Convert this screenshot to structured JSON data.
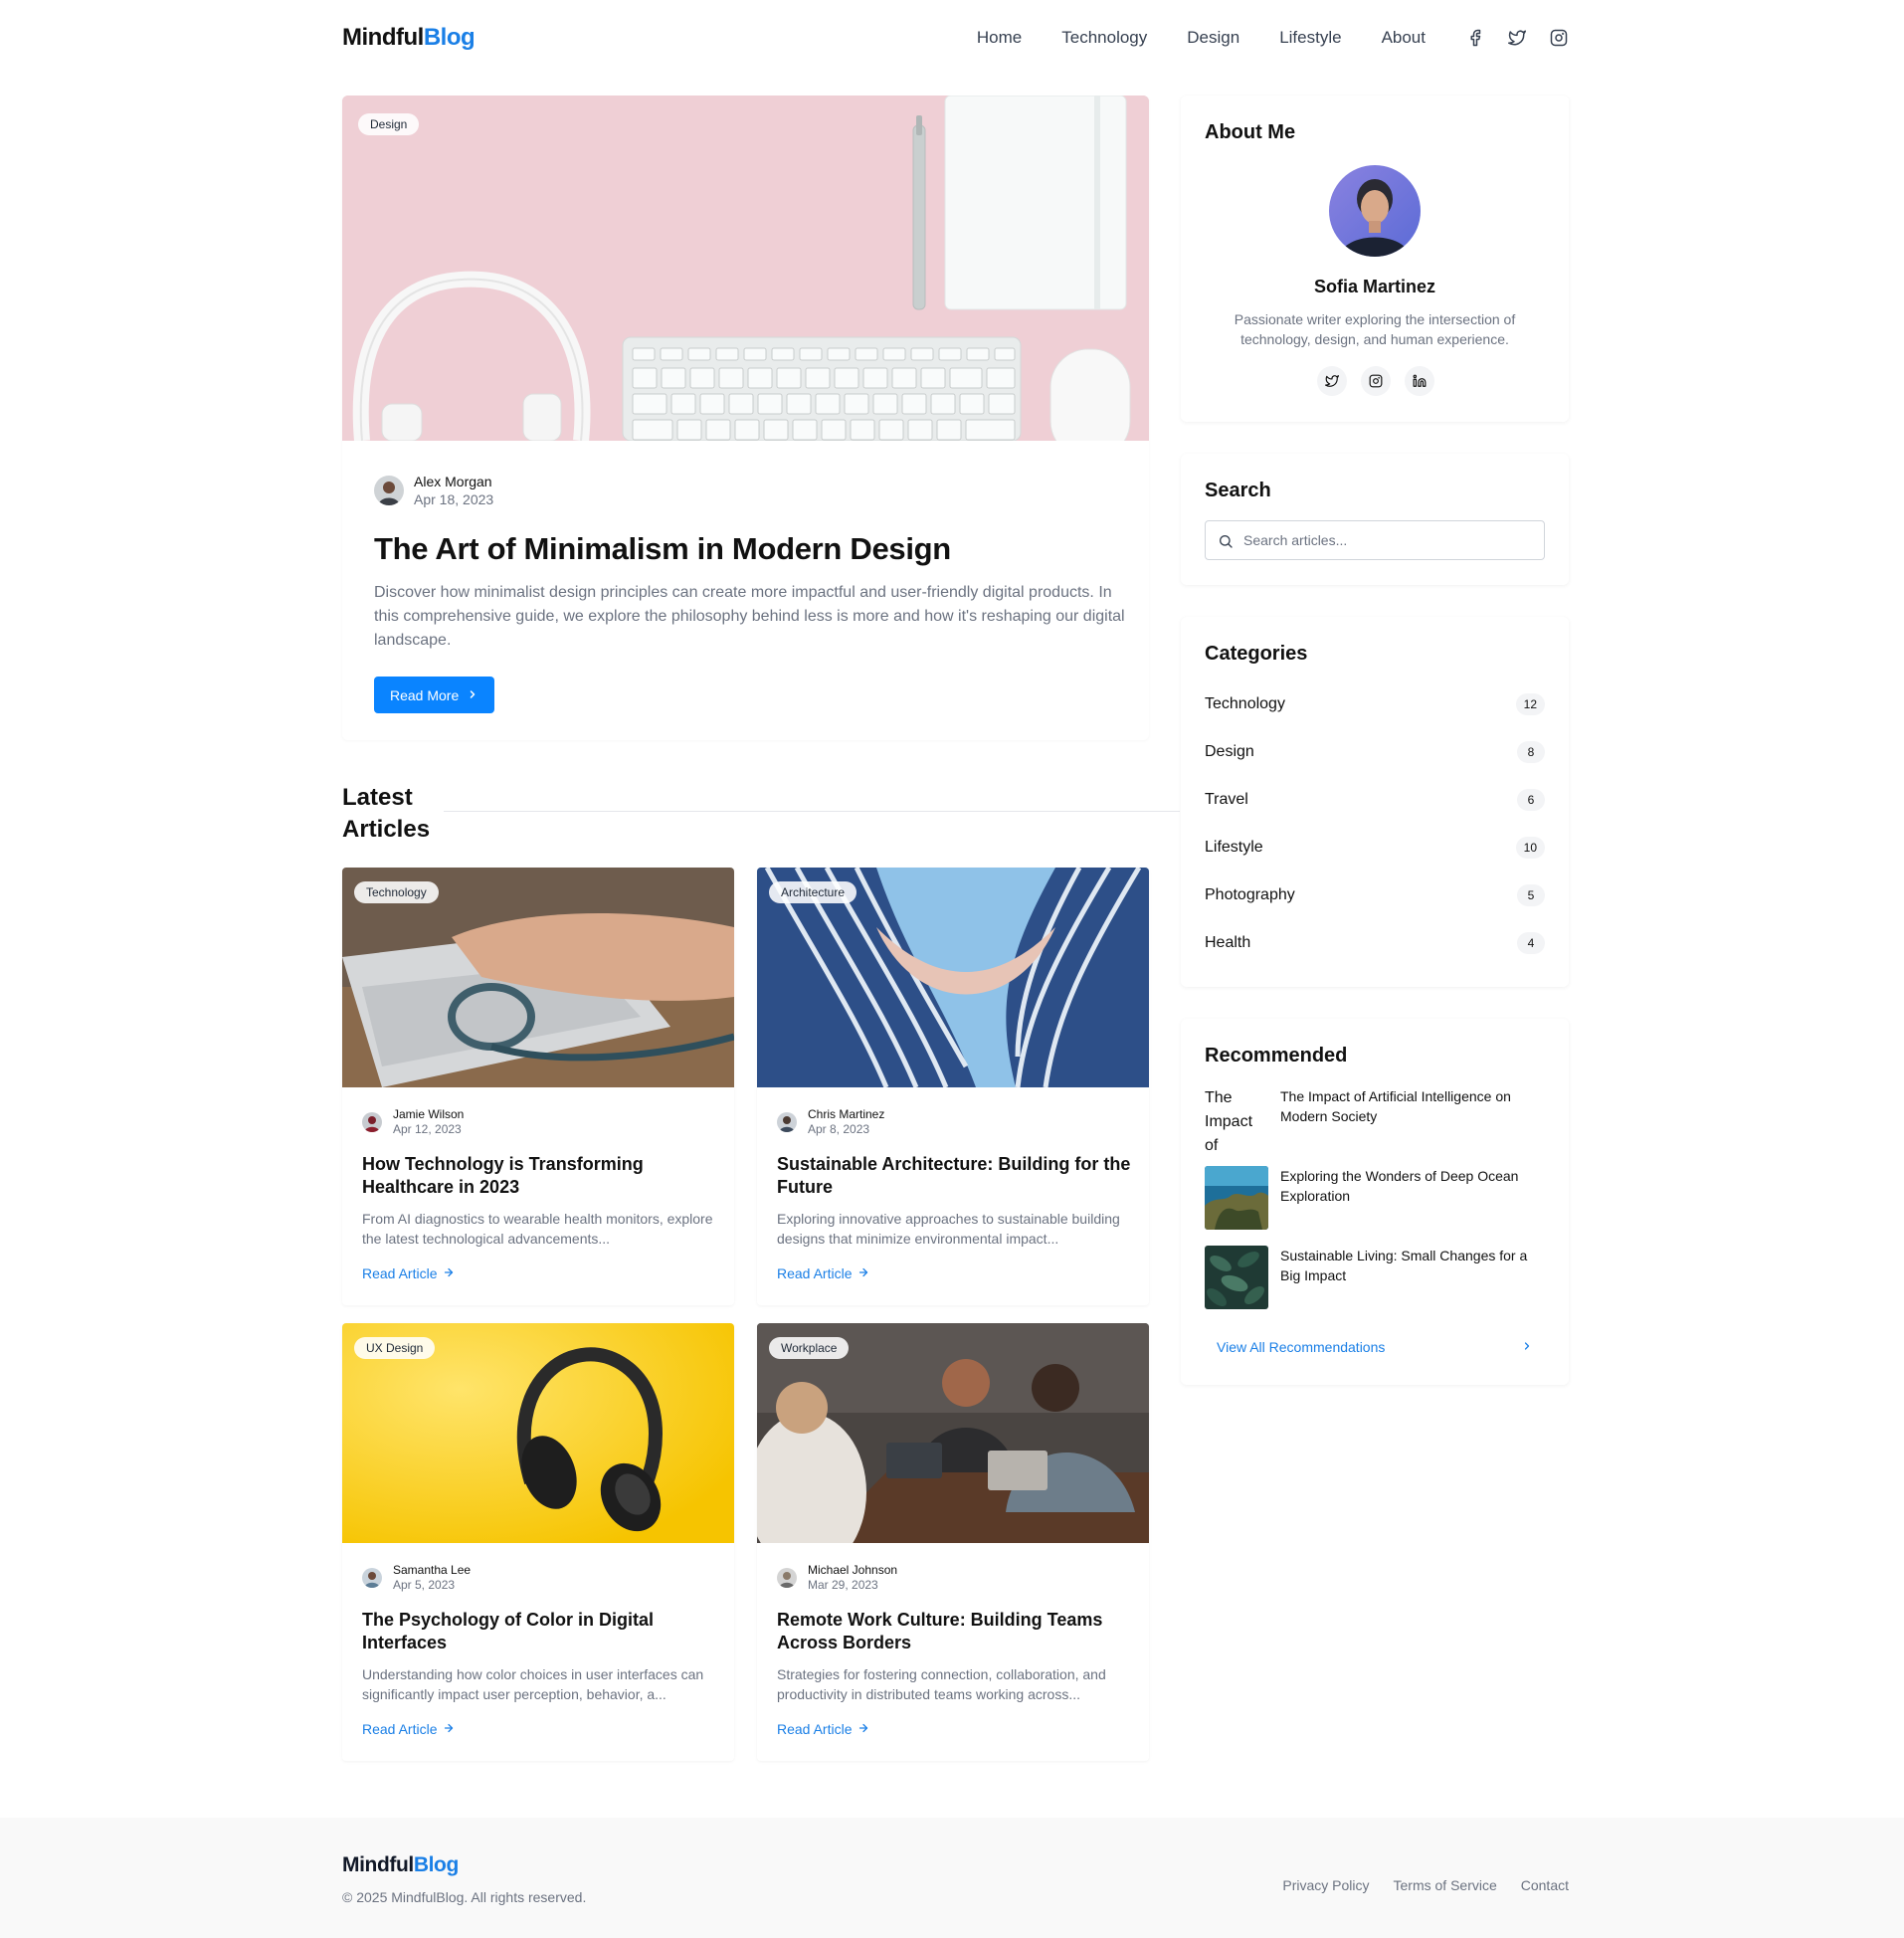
{
  "brand": {
    "name_main": "Mindful",
    "name_accent": "Blog",
    "accent_color": "#1a7fe6"
  },
  "nav": {
    "links": [
      "Home",
      "Technology",
      "Design",
      "Lifestyle",
      "About"
    ],
    "social_icons": [
      "facebook-icon",
      "twitter-icon",
      "instagram-icon"
    ]
  },
  "hero": {
    "category": "Design",
    "author": "Alex Morgan",
    "date": "Apr 18, 2023",
    "title": "The Art of Minimalism in Modern Design",
    "excerpt": "Discover how minimalist design principles can create more impactful and user-friendly digital products. In this comprehensive guide, we explore the philosophy behind less is more and how it's reshaping our digital landscape.",
    "button_label": "Read More"
  },
  "latest": {
    "heading": "Latest Articles",
    "read_label": "Read Article",
    "articles": [
      {
        "category": "Technology",
        "author": "Jamie Wilson",
        "date": "Apr 12, 2023",
        "title": "How Technology is Transforming Healthcare in 2023",
        "excerpt": "From AI diagnostics to wearable health monitors, explore the latest technological advancements..."
      },
      {
        "category": "Architecture",
        "author": "Chris Martinez",
        "date": "Apr 8, 2023",
        "title": "Sustainable Architecture: Building for the Future",
        "excerpt": "Exploring innovative approaches to sustainable building designs that minimize environmental impact..."
      },
      {
        "category": "UX Design",
        "author": "Samantha Lee",
        "date": "Apr 5, 2023",
        "title": "The Psychology of Color in Digital Interfaces",
        "excerpt": "Understanding how color choices in user interfaces can significantly impact user perception, behavior, a..."
      },
      {
        "category": "Workplace",
        "author": "Michael Johnson",
        "date": "Mar 29, 2023",
        "title": "Remote Work Culture: Building Teams Across Borders",
        "excerpt": "Strategies for fostering connection, collaboration, and productivity in distributed teams working across..."
      }
    ]
  },
  "sidebar": {
    "about": {
      "title": "About Me",
      "name": "Sofia Martinez",
      "bio": "Passionate writer exploring the intersection of technology, design, and human experience.",
      "social_icons": [
        "twitter-icon",
        "instagram-icon",
        "linkedin-icon"
      ]
    },
    "search": {
      "title": "Search",
      "placeholder": "Search articles..."
    },
    "categories": {
      "title": "Categories",
      "items": [
        {
          "label": "Technology",
          "count": "12"
        },
        {
          "label": "Design",
          "count": "8"
        },
        {
          "label": "Travel",
          "count": "6"
        },
        {
          "label": "Lifestyle",
          "count": "10"
        },
        {
          "label": "Photography",
          "count": "5"
        },
        {
          "label": "Health",
          "count": "4"
        }
      ]
    },
    "recommended": {
      "title": "Recommended",
      "items": [
        {
          "title": "The Impact of Artificial Intelligence on Modern Society",
          "broken_alt": "The Impact of"
        },
        {
          "title": "Exploring the Wonders of Deep Ocean Exploration"
        },
        {
          "title": "Sustainable Living: Small Changes for a Big Impact"
        }
      ],
      "view_all": "View All Recommendations"
    }
  },
  "footer": {
    "copyright": "© 2025 MindfulBlog. All rights reserved.",
    "links": [
      "Privacy Policy",
      "Terms of Service",
      "Contact"
    ]
  }
}
